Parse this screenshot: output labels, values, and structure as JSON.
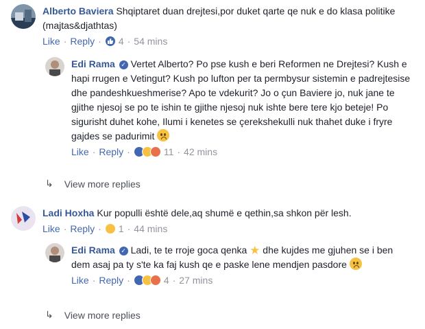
{
  "comments": [
    {
      "author": "Alberto Baviera",
      "text": "Shqiptaret duan drejtesi,por duket qarte qe nuk e do klasa politike (majtas&djathtas)",
      "like": "Like",
      "reply": "Reply",
      "reaction_count": "4",
      "time": "54 mins",
      "reply_block": {
        "author": "Edi Rama",
        "text": "Vertet Alberto? Po pse kush e beri Reformen ne Drejtesi? Kush e hapi rrugen e Vetingut? Kush po lufton per ta permbysur sistemin e padrejtesise dhe pandeshkueshmerise? Apo te vdekurit? Jo o çun Baviere jo, nuk jane te gjithe njesoj se po te ishin te gjithe njesoj nuk ishte bere tere kjo beteje! Po sigurisht duhet kohe, Ilumi i kenetes se çerekshekulli nuk thahet duke i fryre gajdes se padurimit",
        "like": "Like",
        "reply": "Reply",
        "reaction_count": "11",
        "time": "42 mins"
      },
      "view_more": "View more replies"
    },
    {
      "author": "Ladi Hoxha",
      "text": "Kur populli është dele,aq shumë e qethin,sa shkon për lesh.",
      "like": "Like",
      "reply": "Reply",
      "reaction_count": "1",
      "time": "44 mins",
      "reply_block": {
        "author": "Edi Rama",
        "text_part1": "Ladi, te te rroje goca qenka",
        "text_part2": "dhe kujdes me gjuhen se i ben dem asaj pa ty s'te ka faj kush qe e paske lene mendjen pasdore",
        "like": "Like",
        "reply": "Reply",
        "reaction_count": "4",
        "time": "27 mins"
      },
      "view_more": "View more replies"
    }
  ],
  "colors": {
    "link": "#365899",
    "action": "#4267b2",
    "meta": "#90949c"
  }
}
